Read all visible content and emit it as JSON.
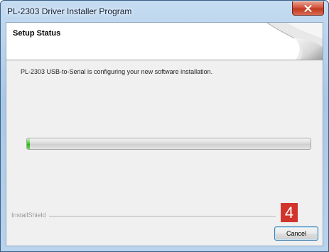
{
  "window": {
    "title": "PL-2303 Driver Installer Program",
    "close_icon": "close-icon"
  },
  "header": {
    "title": "Setup Status",
    "art_icon": "page-curl-graphic"
  },
  "main": {
    "status_message": "PL-2303 USB-to-Serial is configuring your new software installation.",
    "progress_fraction": 0.01
  },
  "footer": {
    "brand": "InstallShield",
    "cancel_label": "Cancel"
  },
  "annotation": {
    "step_number": "4"
  },
  "colors": {
    "progress_green": "#2fb41c",
    "badge_red": "#d1342c",
    "close_red": "#c13a20"
  }
}
